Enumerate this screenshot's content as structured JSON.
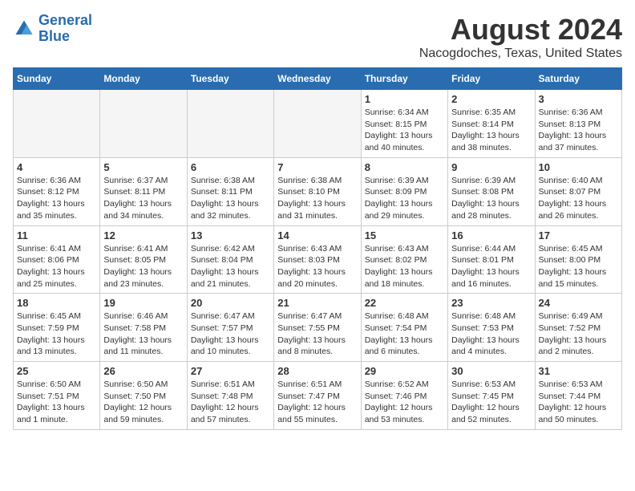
{
  "header": {
    "logo_line1": "General",
    "logo_line2": "Blue",
    "title": "August 2024",
    "subtitle": "Nacogdoches, Texas, United States"
  },
  "calendar": {
    "days_of_week": [
      "Sunday",
      "Monday",
      "Tuesday",
      "Wednesday",
      "Thursday",
      "Friday",
      "Saturday"
    ],
    "weeks": [
      [
        {
          "day": "",
          "detail": ""
        },
        {
          "day": "",
          "detail": ""
        },
        {
          "day": "",
          "detail": ""
        },
        {
          "day": "",
          "detail": ""
        },
        {
          "day": "1",
          "detail": "Sunrise: 6:34 AM\nSunset: 8:15 PM\nDaylight: 13 hours\nand 40 minutes."
        },
        {
          "day": "2",
          "detail": "Sunrise: 6:35 AM\nSunset: 8:14 PM\nDaylight: 13 hours\nand 38 minutes."
        },
        {
          "day": "3",
          "detail": "Sunrise: 6:36 AM\nSunset: 8:13 PM\nDaylight: 13 hours\nand 37 minutes."
        }
      ],
      [
        {
          "day": "4",
          "detail": "Sunrise: 6:36 AM\nSunset: 8:12 PM\nDaylight: 13 hours\nand 35 minutes."
        },
        {
          "day": "5",
          "detail": "Sunrise: 6:37 AM\nSunset: 8:11 PM\nDaylight: 13 hours\nand 34 minutes."
        },
        {
          "day": "6",
          "detail": "Sunrise: 6:38 AM\nSunset: 8:11 PM\nDaylight: 13 hours\nand 32 minutes."
        },
        {
          "day": "7",
          "detail": "Sunrise: 6:38 AM\nSunset: 8:10 PM\nDaylight: 13 hours\nand 31 minutes."
        },
        {
          "day": "8",
          "detail": "Sunrise: 6:39 AM\nSunset: 8:09 PM\nDaylight: 13 hours\nand 29 minutes."
        },
        {
          "day": "9",
          "detail": "Sunrise: 6:39 AM\nSunset: 8:08 PM\nDaylight: 13 hours\nand 28 minutes."
        },
        {
          "day": "10",
          "detail": "Sunrise: 6:40 AM\nSunset: 8:07 PM\nDaylight: 13 hours\nand 26 minutes."
        }
      ],
      [
        {
          "day": "11",
          "detail": "Sunrise: 6:41 AM\nSunset: 8:06 PM\nDaylight: 13 hours\nand 25 minutes."
        },
        {
          "day": "12",
          "detail": "Sunrise: 6:41 AM\nSunset: 8:05 PM\nDaylight: 13 hours\nand 23 minutes."
        },
        {
          "day": "13",
          "detail": "Sunrise: 6:42 AM\nSunset: 8:04 PM\nDaylight: 13 hours\nand 21 minutes."
        },
        {
          "day": "14",
          "detail": "Sunrise: 6:43 AM\nSunset: 8:03 PM\nDaylight: 13 hours\nand 20 minutes."
        },
        {
          "day": "15",
          "detail": "Sunrise: 6:43 AM\nSunset: 8:02 PM\nDaylight: 13 hours\nand 18 minutes."
        },
        {
          "day": "16",
          "detail": "Sunrise: 6:44 AM\nSunset: 8:01 PM\nDaylight: 13 hours\nand 16 minutes."
        },
        {
          "day": "17",
          "detail": "Sunrise: 6:45 AM\nSunset: 8:00 PM\nDaylight: 13 hours\nand 15 minutes."
        }
      ],
      [
        {
          "day": "18",
          "detail": "Sunrise: 6:45 AM\nSunset: 7:59 PM\nDaylight: 13 hours\nand 13 minutes."
        },
        {
          "day": "19",
          "detail": "Sunrise: 6:46 AM\nSunset: 7:58 PM\nDaylight: 13 hours\nand 11 minutes."
        },
        {
          "day": "20",
          "detail": "Sunrise: 6:47 AM\nSunset: 7:57 PM\nDaylight: 13 hours\nand 10 minutes."
        },
        {
          "day": "21",
          "detail": "Sunrise: 6:47 AM\nSunset: 7:55 PM\nDaylight: 13 hours\nand 8 minutes."
        },
        {
          "day": "22",
          "detail": "Sunrise: 6:48 AM\nSunset: 7:54 PM\nDaylight: 13 hours\nand 6 minutes."
        },
        {
          "day": "23",
          "detail": "Sunrise: 6:48 AM\nSunset: 7:53 PM\nDaylight: 13 hours\nand 4 minutes."
        },
        {
          "day": "24",
          "detail": "Sunrise: 6:49 AM\nSunset: 7:52 PM\nDaylight: 13 hours\nand 2 minutes."
        }
      ],
      [
        {
          "day": "25",
          "detail": "Sunrise: 6:50 AM\nSunset: 7:51 PM\nDaylight: 13 hours\nand 1 minute."
        },
        {
          "day": "26",
          "detail": "Sunrise: 6:50 AM\nSunset: 7:50 PM\nDaylight: 12 hours\nand 59 minutes."
        },
        {
          "day": "27",
          "detail": "Sunrise: 6:51 AM\nSunset: 7:48 PM\nDaylight: 12 hours\nand 57 minutes."
        },
        {
          "day": "28",
          "detail": "Sunrise: 6:51 AM\nSunset: 7:47 PM\nDaylight: 12 hours\nand 55 minutes."
        },
        {
          "day": "29",
          "detail": "Sunrise: 6:52 AM\nSunset: 7:46 PM\nDaylight: 12 hours\nand 53 minutes."
        },
        {
          "day": "30",
          "detail": "Sunrise: 6:53 AM\nSunset: 7:45 PM\nDaylight: 12 hours\nand 52 minutes."
        },
        {
          "day": "31",
          "detail": "Sunrise: 6:53 AM\nSunset: 7:44 PM\nDaylight: 12 hours\nand 50 minutes."
        }
      ]
    ]
  }
}
